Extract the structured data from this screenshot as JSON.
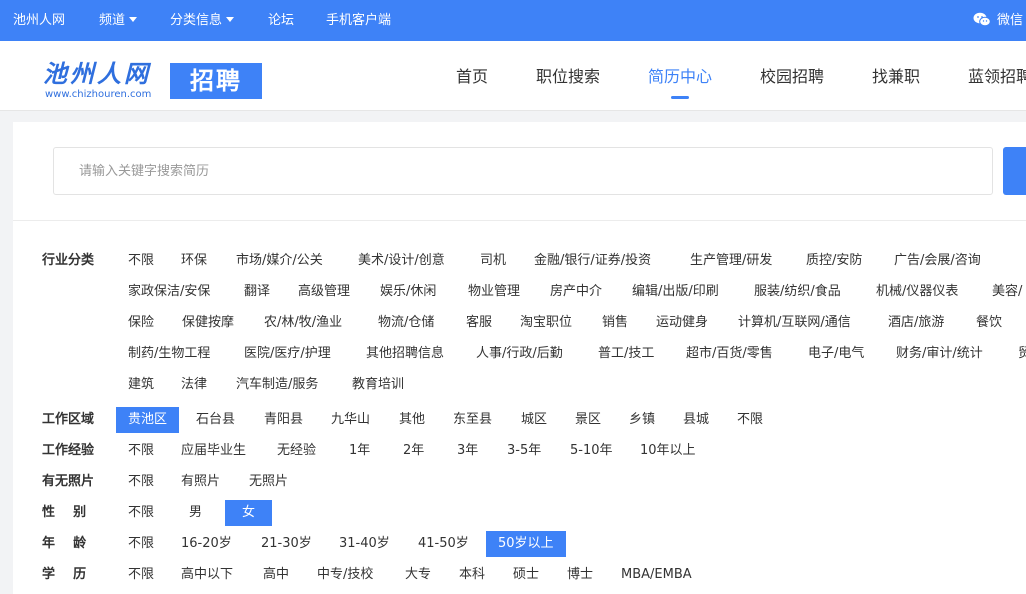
{
  "topbar": {
    "site": "池州人网",
    "channel": "频道",
    "classified": "分类信息",
    "forum": "论坛",
    "mobile": "手机客户端",
    "wechat": "微信",
    "bg_color": "#3e82f7"
  },
  "logo": {
    "cn": "池州人网",
    "en": "www.chizhouren.com",
    "badge": "招聘"
  },
  "nav": {
    "items": [
      "首页",
      "职位搜索",
      "简历中心",
      "校园招聘",
      "找兼职",
      "蓝领招聘"
    ],
    "active": "简历中心"
  },
  "search": {
    "placeholder": "请输入关键字搜索简历"
  },
  "filters": {
    "industry": {
      "label": "行业分类",
      "rows": [
        [
          "不限",
          "环保",
          "市场/媒介/公关",
          "美术/设计/创意",
          "司机",
          "金融/银行/证券/投资",
          "生产管理/研发",
          "质控/安防",
          "广告/会展/咨询"
        ],
        [
          "家政保洁/安保",
          "翻译",
          "高级管理",
          "娱乐/休闲",
          "物业管理",
          "房产中介",
          "编辑/出版/印刷",
          "服装/纺织/食品",
          "机械/仪器仪表",
          "美容/"
        ],
        [
          "保险",
          "保健按摩",
          "农/林/牧/渔业",
          "物流/仓储",
          "客服",
          "淘宝职位",
          "销售",
          "运动健身",
          "计算机/互联网/通信",
          "酒店/旅游",
          "餐饮"
        ],
        [
          "制药/生物工程",
          "医院/医疗/护理",
          "其他招聘信息",
          "人事/行政/后勤",
          "普工/技工",
          "超市/百货/零售",
          "电子/电气",
          "财务/审计/统计",
          "贸"
        ],
        [
          "建筑",
          "法律",
          "汽车制造/服务",
          "教育培训"
        ]
      ]
    },
    "area": {
      "label": "工作区域",
      "options": [
        "贵池区",
        "石台县",
        "青阳县",
        "九华山",
        "其他",
        "东至县",
        "城区",
        "景区",
        "乡镇",
        "县城",
        "不限"
      ],
      "selected": "贵池区"
    },
    "experience": {
      "label": "工作经验",
      "options": [
        "不限",
        "应届毕业生",
        "无经验",
        "1年",
        "2年",
        "3年",
        "3-5年",
        "5-10年",
        "10年以上"
      ]
    },
    "photo": {
      "label": "有无照片",
      "options": [
        "不限",
        "有照片",
        "无照片"
      ]
    },
    "gender": {
      "label": "性    别",
      "options": [
        "不限",
        "男",
        "女"
      ],
      "selected": "女"
    },
    "age": {
      "label": "年    龄",
      "options": [
        "不限",
        "16-20岁",
        "21-30岁",
        "31-40岁",
        "41-50岁",
        "50岁以上"
      ],
      "selected": "50岁以上"
    },
    "education": {
      "label": "学    历",
      "options": [
        "不限",
        "高中以下",
        "高中",
        "中专/技校",
        "大专",
        "本科",
        "硕士",
        "博士",
        "MBA/EMBA"
      ]
    }
  }
}
